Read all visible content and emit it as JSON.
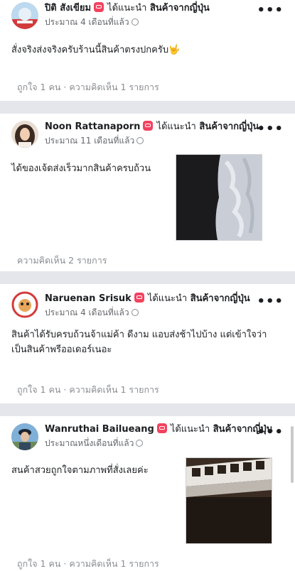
{
  "recommends_label": "ได้แนะนำ",
  "page_name": "สินค้าจากญี่ปุ่น",
  "more_label": "•••",
  "posts": [
    {
      "author": "ปิติ สังเขียม",
      "time": "ประมาณ 4 เดือนที่แล้ว",
      "text_lines": [
        "สั่งจริงส่งจริงครับร้านนี้สินค้าตรงปกครับ🤟"
      ],
      "footer_like": "ถูกใจ 1 คน",
      "footer_comment": "ความคิดเห็น 1 รายการ",
      "separator": "·"
    },
    {
      "author": "Noon Rattanaporn",
      "time": "ประมาณ 11 เดือนที่แล้ว",
      "text_lines": [
        "ได้ของเจ้ดส่งเร็วมากสินค้าครบถ้วน"
      ],
      "footer_like": "",
      "footer_comment": "ความคิดเห็น 2 รายการ",
      "separator": ""
    },
    {
      "author": "Naruenan Srisuk",
      "time": "ประมาณ 4 เดือนที่แล้ว",
      "text_lines": [
        "สินค้าได้รับครบถ้วนจ้าแม่ค้า ดีงาม แอบส่งช้าไปบ้าง แต่เข้าใจว่า",
        "เป็นสินค้าพรีออเดอร์เนอะ"
      ],
      "footer_like": "ถูกใจ 1 คน",
      "footer_comment": "ความคิดเห็น 1 รายการ",
      "separator": "·"
    },
    {
      "author": "Wanruthai Bailueang",
      "time": "ประมาณหนึ่งเดือนที่แล้ว",
      "text_lines": [
        "สนค้าสวยถูกใจตามภาพที่สั่งเลยค่ะ"
      ],
      "footer_like": "ถูกใจ 1 คน",
      "footer_comment": "ความคิดเห็น 1 รายการ",
      "separator": "·"
    }
  ]
}
